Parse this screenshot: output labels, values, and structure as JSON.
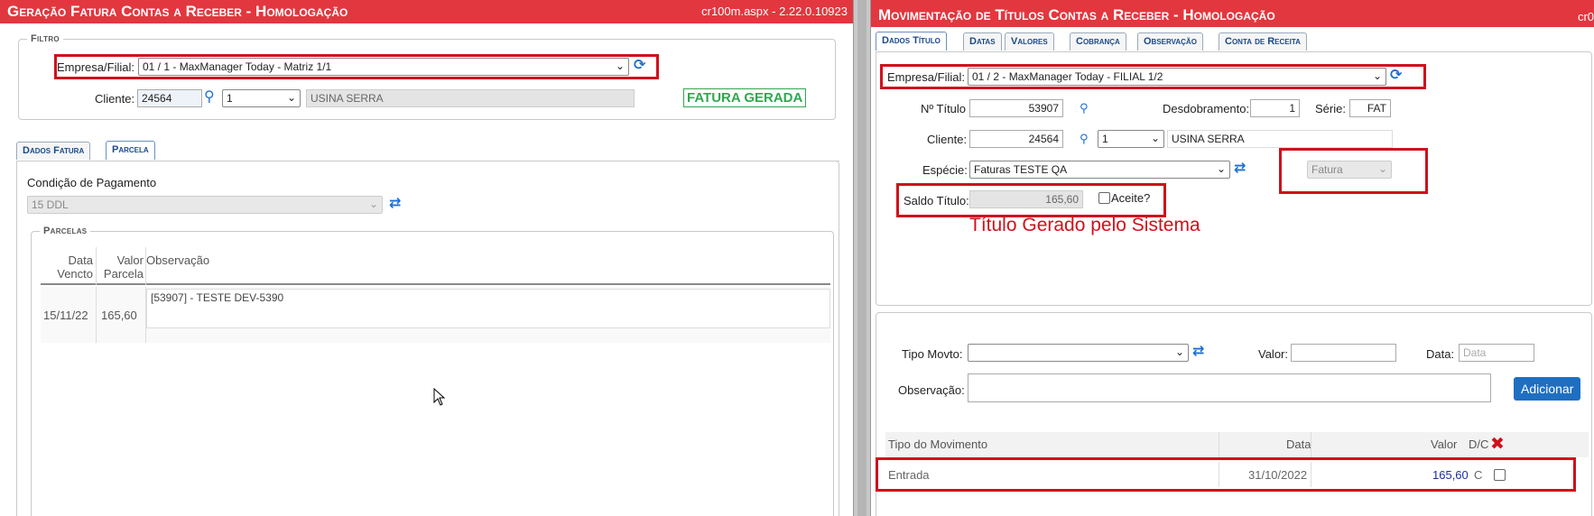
{
  "left": {
    "title": "Geração Fatura Contas a Receber  - Homologação",
    "version": "cr100m.aspx - 2.22.0.10923",
    "filter_legend": "Filtro",
    "empresa_label": "Empresa/Filial:",
    "empresa_value": "01 / 1 - MaxManager Today - Matriz 1/1",
    "cliente_label": "Cliente:",
    "cliente_code": "24564",
    "cliente_seq": "1",
    "cliente_name": "USINA SERRA",
    "status_badge": "FATURA GERADA",
    "tabs": [
      {
        "label": "Dados Fatura"
      },
      {
        "label": "Parcela"
      }
    ],
    "condicao_label": "Condição de Pagamento",
    "condicao_value": "15 DDL",
    "parcelas_legend": "Parcelas",
    "table_headers": {
      "data_l1": "Data",
      "data_l2": "Vencto",
      "valor_l1": "Valor",
      "valor_l2": "Parcela",
      "obs": "Observação"
    },
    "rows": [
      {
        "data": "15/11/22",
        "valor": "165,60",
        "obs": "[53907] - TESTE DEV-5390"
      }
    ]
  },
  "right": {
    "title": "Movimentação de Títulos Contas a Receber  - Homologação",
    "version": "cr0",
    "tabs": [
      {
        "label": "Dados Título"
      },
      {
        "label": "Datas"
      },
      {
        "label": "Valores"
      },
      {
        "label": "Cobrança"
      },
      {
        "label": "Observação"
      },
      {
        "label": "Conta de Receita"
      }
    ],
    "empresa_label": "Empresa/Filial:",
    "empresa_value": "01 / 2 - MaxManager Today - FILIAL 1/2",
    "titulo_label": "Nº Título",
    "titulo_value": "53907",
    "desdobramento_label": "Desdobramento:",
    "desdobramento_value": "1",
    "serie_label": "Série:",
    "serie_value": "FAT",
    "cliente_label": "Cliente:",
    "cliente_code": "24564",
    "cliente_seq": "1",
    "cliente_name": "USINA SERRA",
    "especie_label": "Espécie:",
    "especie_value": "Faturas TESTE QA",
    "tipo_value": "Fatura",
    "saldo_label": "Saldo Título:",
    "saldo_value": "165,60",
    "aceite_label": "Aceite?",
    "annotation": "Título Gerado pelo Sistema",
    "tipo_movto_label": "Tipo Movto:",
    "valor_label": "Valor:",
    "data_label": "Data:",
    "data_placeholder": "Data",
    "observacao_label": "Observação:",
    "adicionar_label": "Adicionar",
    "mov_headers": {
      "tipo": "Tipo do Movimento",
      "data": "Data",
      "valor": "Valor",
      "dc": "D/C"
    },
    "mov_rows": [
      {
        "tipo": "Entrada",
        "data": "31/10/2022",
        "valor": "165,60",
        "dc": "C"
      }
    ]
  },
  "colors": {
    "title_bar": "#e2373f",
    "annotation_red": "#d0101b",
    "success_green": "#2fa84f",
    "link_blue": "#1e6fc2"
  }
}
